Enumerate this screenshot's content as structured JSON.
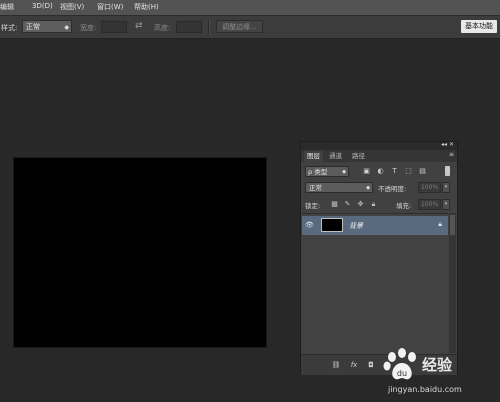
{
  "menubar": {
    "items": [
      "编辑",
      "3D(D)",
      "视图(V)",
      "窗口(W)",
      "帮助(H)"
    ]
  },
  "options_bar": {
    "style_label": "样式:",
    "style_value": "正常",
    "width_label": "宽度:",
    "swap_icon": "swap-arrows-icon",
    "height_label": "高度:",
    "refine_edge_button": "调整边缘...",
    "workspace_button": "基本功能"
  },
  "layers_panel": {
    "tabs": [
      "图层",
      "通道",
      "路径"
    ],
    "active_tab": "图层",
    "filter": {
      "kind_label": "ρ 类型",
      "icons": [
        "image-filter-icon",
        "adjustment-filter-icon",
        "type-filter-icon",
        "shape-filter-icon",
        "smart-object-filter-icon"
      ]
    },
    "blend_mode": "正常",
    "opacity_label": "不透明度:",
    "opacity_value": "100%",
    "lock_label": "锁定:",
    "fill_label": "填充:",
    "fill_value": "100%",
    "layers": [
      {
        "name": "背景",
        "visible": true,
        "locked": true,
        "thumbnail_color": "#000000",
        "selected": true
      }
    ],
    "footer_icons": [
      "link-layers-icon",
      "fx-icon",
      "add-mask-icon",
      "adjustment-layer-icon",
      "group-icon",
      "new-layer-icon",
      "delete-layer-icon"
    ]
  },
  "canvas": {
    "fill_color": "#000000"
  },
  "watermark": {
    "brand": "经验",
    "url": "jingyan.baidu.com"
  }
}
